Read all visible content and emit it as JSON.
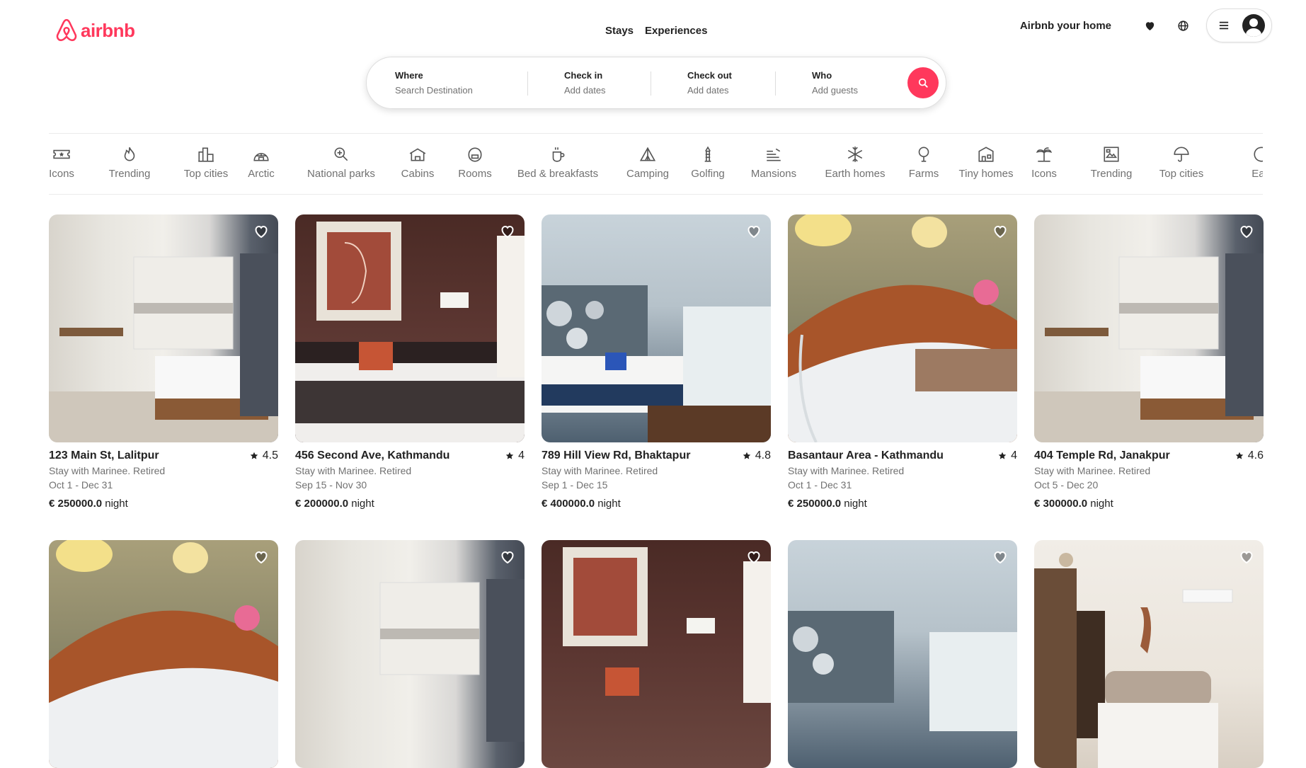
{
  "brand": {
    "name": "airbnb",
    "color": "#ff385c"
  },
  "nav": {
    "stays": "Stays",
    "experiences": "Experiences"
  },
  "header_right": {
    "host_label": "Airbnb your home",
    "heart_icon": "heart-icon",
    "globe_icon": "globe-icon",
    "menu_icon": "hamburger-icon",
    "avatar_icon": "user-avatar-icon"
  },
  "search": {
    "where_title": "Where",
    "where_placeholder": "Search Destination",
    "checkin_title": "Check in",
    "checkin_value": "Add dates",
    "checkout_title": "Check out",
    "checkout_value": "Add dates",
    "who_title": "Who",
    "who_value": "Add guests"
  },
  "categories": [
    {
      "label": "Icons",
      "icon": "ticket-icon"
    },
    {
      "label": "Trending",
      "icon": "flame-icon"
    },
    {
      "label": "Top cities",
      "icon": "city-icon"
    },
    {
      "label": "Arctic",
      "icon": "igloo-icon"
    },
    {
      "label": "National parks",
      "icon": "park-icon"
    },
    {
      "label": "Cabins",
      "icon": "cabin-icon"
    },
    {
      "label": "Rooms",
      "icon": "room-icon"
    },
    {
      "label": "Bed & breakfasts",
      "icon": "coffee-icon"
    },
    {
      "label": "Camping",
      "icon": "tent-icon"
    },
    {
      "label": "Golfing",
      "icon": "golf-icon"
    },
    {
      "label": "Mansions",
      "icon": "mansion-icon"
    },
    {
      "label": "Earth homes",
      "icon": "snowflake-icon"
    },
    {
      "label": "Farms",
      "icon": "farm-icon"
    },
    {
      "label": "Tiny homes",
      "icon": "tiny-home-icon"
    },
    {
      "label": "Icons",
      "icon": "palm-icon"
    },
    {
      "label": "Trending",
      "icon": "frame-icon"
    },
    {
      "label": "Top cities",
      "icon": "umbrella-icon"
    },
    {
      "label": "Eart",
      "icon": "earth-icon"
    }
  ],
  "listings": [
    {
      "title": "123 Main St, Lalitpur",
      "rating": "4.5",
      "host": "Stay with Marinee. Retired",
      "dates": "Oct 1 - Dec 31",
      "price": "€ 250000.0",
      "unit": "night"
    },
    {
      "title": "456 Second Ave, Kathmandu",
      "rating": "4",
      "host": "Stay with Marinee. Retired",
      "dates": "Sep 15 - Nov 30",
      "price": "€ 200000.0",
      "unit": "night"
    },
    {
      "title": "789 Hill View Rd, Bhaktapur",
      "rating": "4.8",
      "host": "Stay with Marinee. Retired",
      "dates": "Sep 1 - Dec 15",
      "price": "€ 400000.0",
      "unit": "night"
    },
    {
      "title": "Basantaur Area - Kathmandu",
      "rating": "4",
      "host": "Stay with Marinee. Retired",
      "dates": "Oct 1 - Dec 31",
      "price": "€ 250000.0",
      "unit": "night"
    },
    {
      "title": "404 Temple Rd, Janakpur",
      "rating": "4.6",
      "host": "Stay with Marinee. Retired",
      "dates": "Oct 5 - Dec 20",
      "price": "€ 300000.0",
      "unit": "night"
    }
  ]
}
